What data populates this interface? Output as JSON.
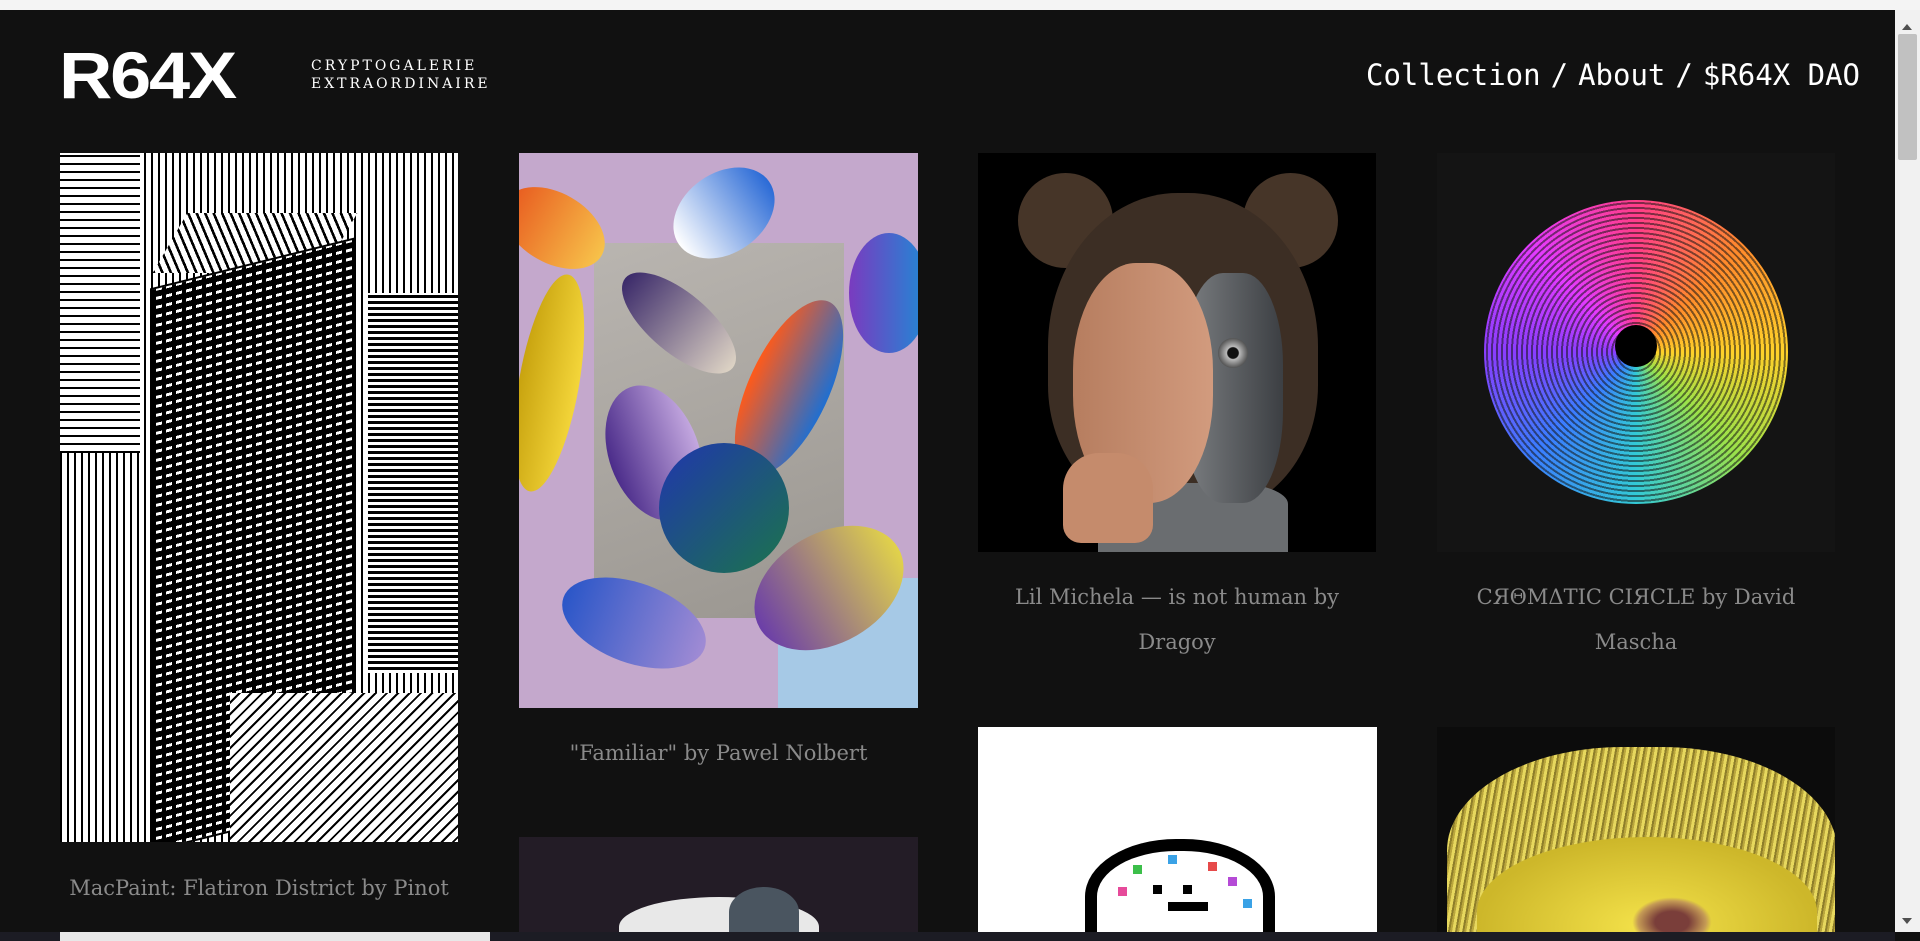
{
  "logo": {
    "mark": "R64X",
    "subtitle_line1": "CRYPTOGALERIE",
    "subtitle_line2": "EXTRAORDINAIRE"
  },
  "nav": {
    "items": [
      {
        "label": "Collection"
      },
      {
        "label": "About"
      },
      {
        "label": "$R64X DAO"
      }
    ],
    "separator": "/"
  },
  "gallery": {
    "items": [
      {
        "caption": "MacPaint: Flatiron District by Pinot"
      },
      {
        "caption": "\"Familiar\" by Pawel Nolbert"
      },
      {
        "caption_line1": "Lil Michela — is not human by",
        "caption_line2": "Dragoy"
      },
      {
        "caption_line1": "CЯΘMΔTIC CIЯCLE by David",
        "caption_line2": "Mascha"
      },
      {
        "caption": ""
      },
      {
        "caption": ""
      },
      {
        "caption": ""
      }
    ]
  },
  "colors": {
    "background": "#111111",
    "text": "#ffffff",
    "caption": "#8a8a8a"
  }
}
